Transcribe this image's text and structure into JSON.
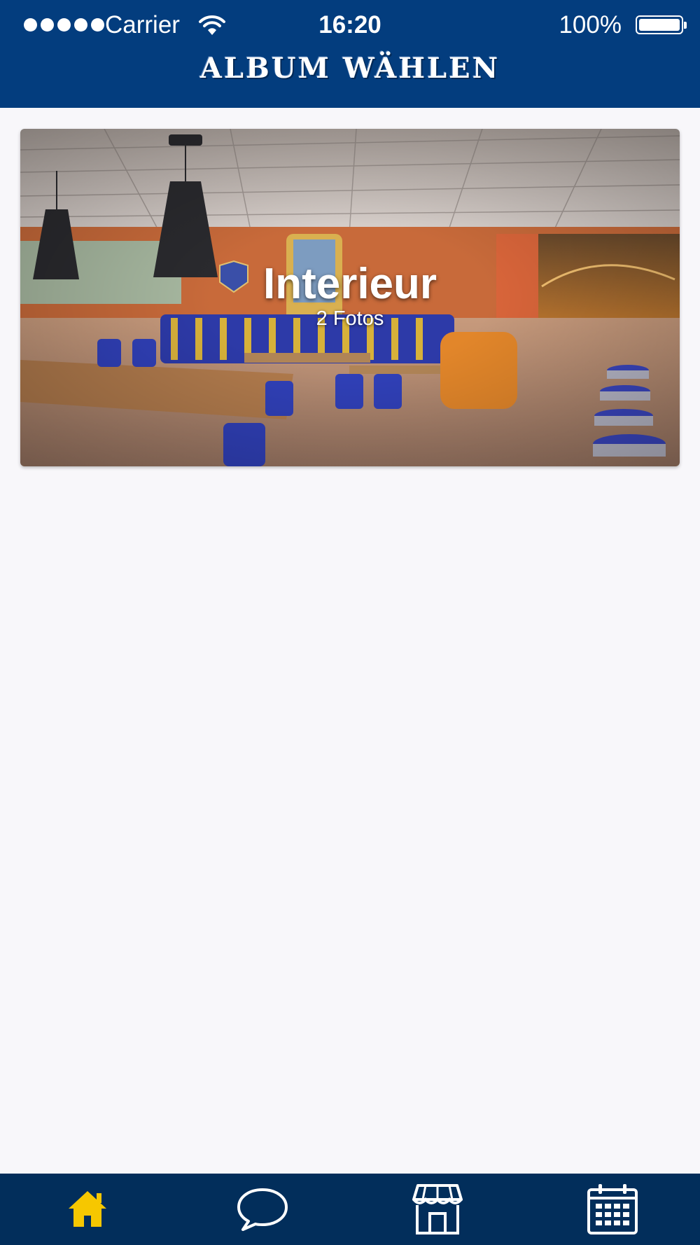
{
  "status_bar": {
    "carrier": "Carrier",
    "time": "16:20",
    "battery": "100%",
    "signal_icon": "signal-dots-icon",
    "wifi_icon": "wifi-icon",
    "battery_icon": "battery-icon"
  },
  "nav": {
    "title": "ALBUM WÄHLEN"
  },
  "albums": [
    {
      "title": "Interieur",
      "count": "2 Fotos"
    }
  ],
  "tabbar": {
    "active_color": "#f6c700",
    "inactive_color": "#ffffff",
    "items": [
      {
        "icon": "home-icon",
        "active": true
      },
      {
        "icon": "chat-bubble-icon",
        "active": false
      },
      {
        "icon": "store-icon",
        "active": false
      },
      {
        "icon": "calendar-icon",
        "active": false
      }
    ]
  },
  "colors": {
    "header": "#033d7e",
    "tabbar": "#022e5b",
    "background": "#f8f7fa"
  }
}
